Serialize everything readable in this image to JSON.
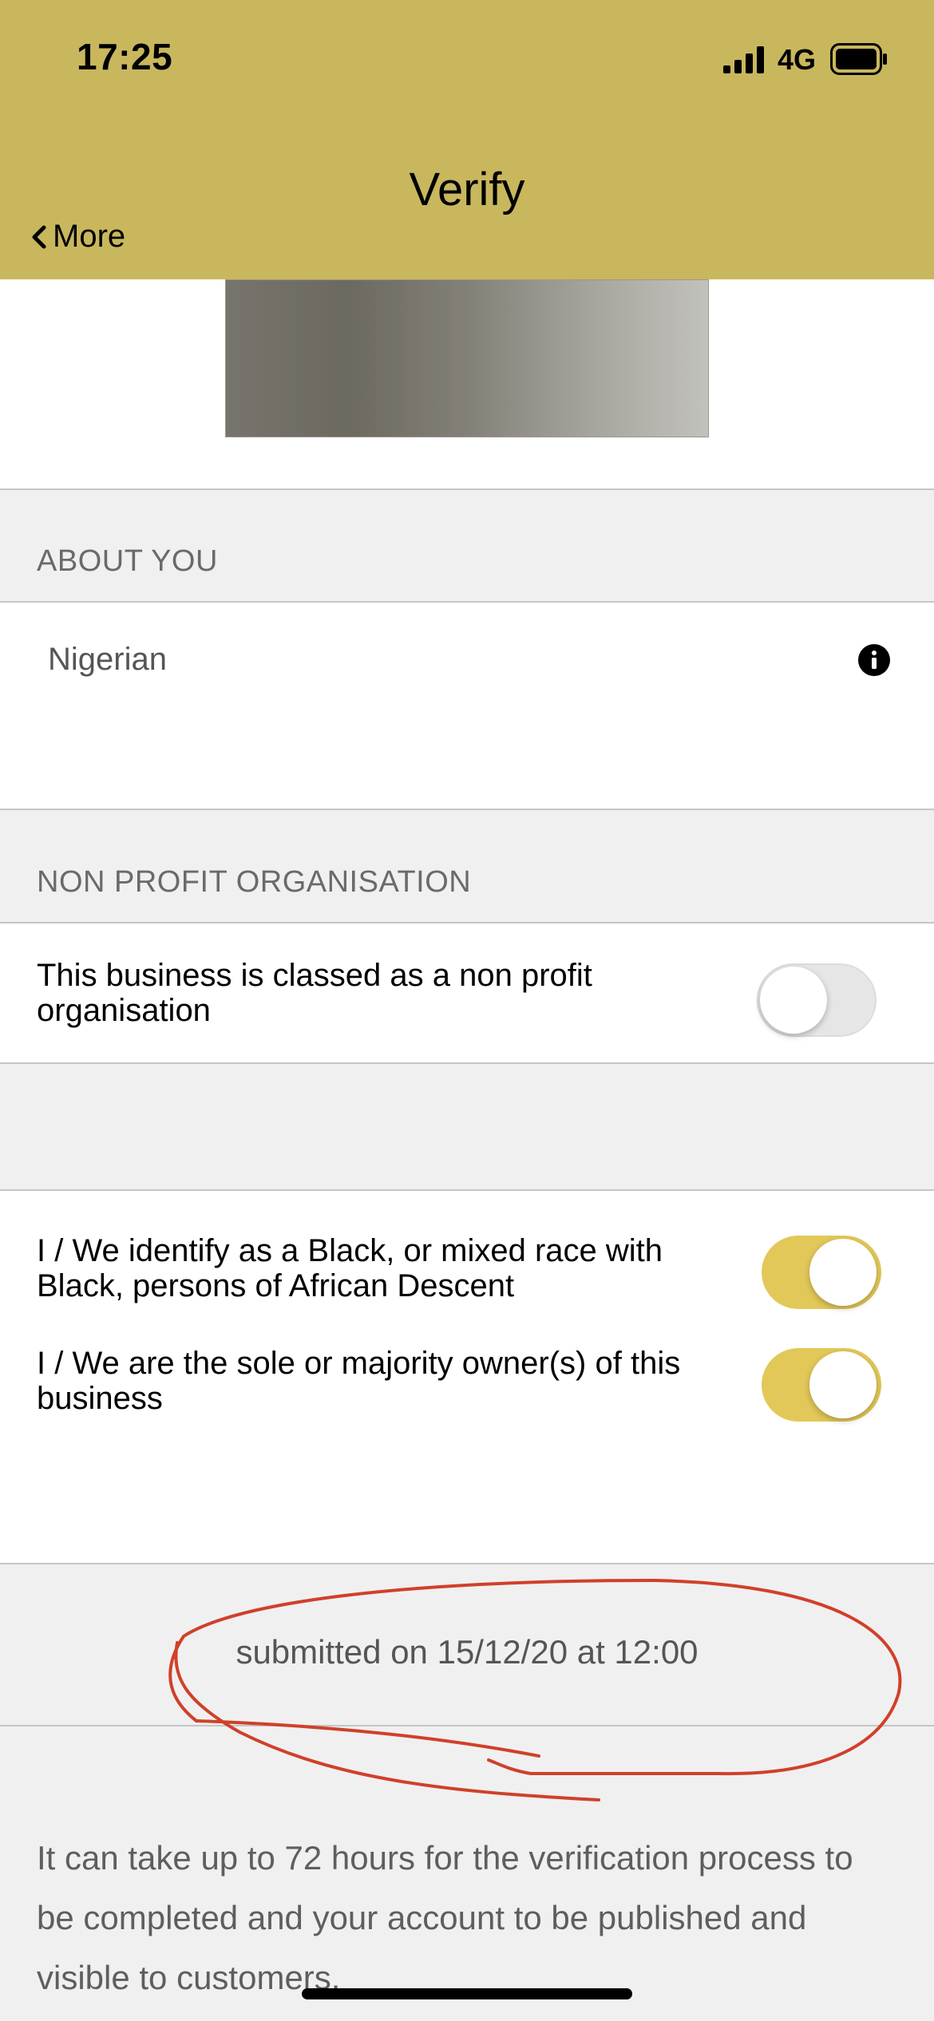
{
  "status_bar": {
    "time": "17:25",
    "network": "4G",
    "icons": [
      "signal-bars-icon",
      "battery-icon"
    ]
  },
  "nav": {
    "title": "Verify",
    "back_label": "More",
    "back_icon": "chevron-left-icon"
  },
  "about_you": {
    "section_label": "ABOUT YOU",
    "nationality_value": "Nigerian",
    "info_icon": "info-circle-icon"
  },
  "non_profit": {
    "section_label": "NON PROFIT ORGANISATION",
    "toggle_label": "This business is classed as a non profit organisation",
    "toggle_on": false
  },
  "identity": {
    "black_identity_label": "I / We identify as a Black, or mixed race with Black, persons of African Descent",
    "black_identity_on": true,
    "owner_label": "I / We are the sole or majority owner(s) of this business",
    "owner_on": true
  },
  "submission": {
    "submitted_text": "submitted on 15/12/20 at 12:00",
    "info_text": "It can take up to 72 hours for the verification process to be completed and your account to be published and visible to customers."
  },
  "colors": {
    "header_bg": "#c9b75e",
    "toggle_on": "#e2c858",
    "annotation": "#d0402a"
  }
}
